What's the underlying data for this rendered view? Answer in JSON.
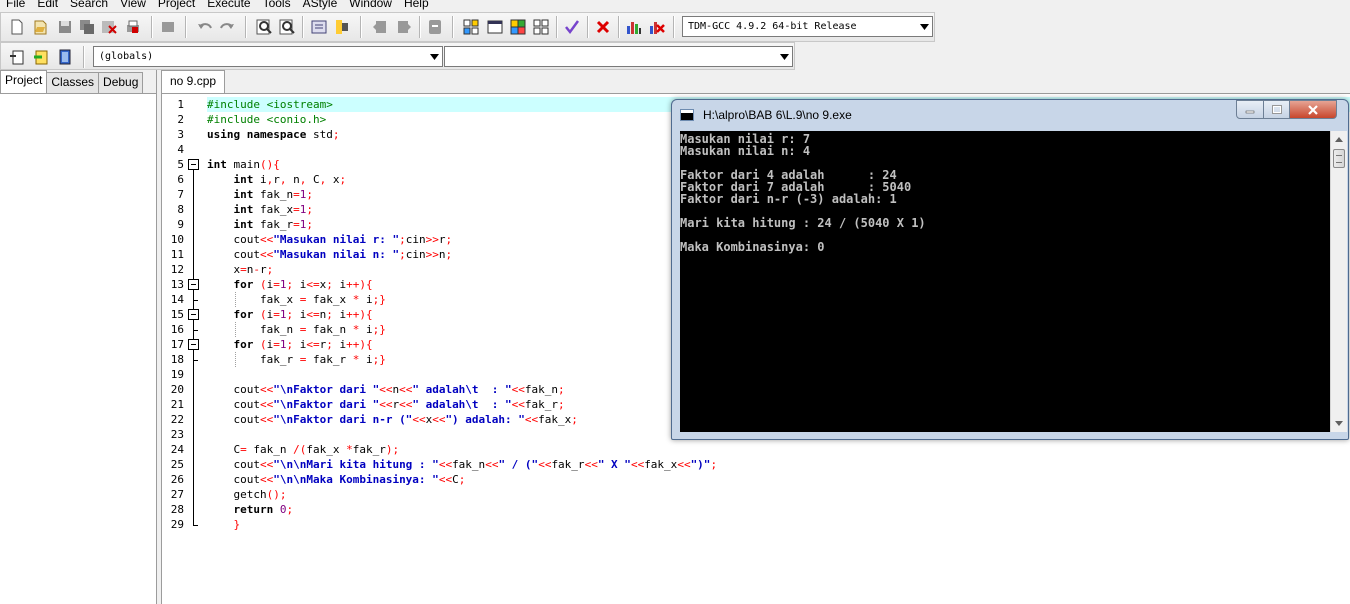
{
  "menu": [
    "File",
    "Edit",
    "Search",
    "View",
    "Project",
    "Execute",
    "Tools",
    "AStyle",
    "Window",
    "Help"
  ],
  "toolbar": {
    "compiler_select": "TDM-GCC 4.9.2 64-bit Release",
    "scope_select": "(globals)",
    "member_select": ""
  },
  "left_panel": {
    "tabs": [
      "Project",
      "Classes",
      "Debug"
    ],
    "active_tab": "Project"
  },
  "editor": {
    "tab": "no 9.cpp",
    "active_line": 1,
    "lines": [
      "#include <iostream>",
      "#include <conio.h>",
      "using namespace std;",
      "",
      "int main(){",
      "    int i,r, n, C, x;",
      "    int fak_n=1;",
      "    int fak_x=1;",
      "    int fak_r=1;",
      "    cout<<\"Masukan nilai r: \";cin>>r;",
      "    cout<<\"Masukan nilai n: \";cin>>n;",
      "    x=n-r;",
      "    for (i=1; i<=x; i++){",
      "        fak_x = fak_x * i;}",
      "    for (i=1; i<=n; i++){",
      "        fak_n = fak_n * i;}",
      "    for (i=1; i<=r; i++){",
      "        fak_r = fak_r * i;}",
      "",
      "    cout<<\"\\nFaktor dari \"<<n<<\" adalah\\t  : \"<<fak_n;",
      "    cout<<\"\\nFaktor dari \"<<r<<\" adalah\\t  : \"<<fak_r;",
      "    cout<<\"\\nFaktor dari n-r (\"<<x<<\") adalah: \"<<fak_x;",
      "",
      "    C= fak_n /(fak_x *fak_r);",
      "    cout<<\"\\n\\nMari kita hitung : \"<<fak_n<<\" / (\"<<fak_r<<\" X \"<<fak_x<<\")\";",
      "    cout<<\"\\n\\nMaka Kombinasinya: \"<<C;",
      "    getch();",
      "    return 0;",
      "    }"
    ]
  },
  "console": {
    "title": "H:\\alpro\\BAB 6\\L.9\\no 9.exe",
    "output": [
      "Masukan nilai r: 7",
      "Masukan nilai n: 4",
      "",
      "Faktor dari 4 adalah      : 24",
      "Faktor dari 7 adalah      : 5040",
      "Faktor dari n-r (-3) adalah: 1",
      "",
      "Mari kita hitung : 24 / (5040 X 1)",
      "",
      "Maka Kombinasinya: 0"
    ]
  },
  "colors": {
    "active_line": "#ccffff",
    "preprocessor": "#008000",
    "string": "#0000c0",
    "number": "#800080",
    "symbol": "#ff0000",
    "console_bg": "#000000",
    "console_text": "#c0c0c0"
  }
}
